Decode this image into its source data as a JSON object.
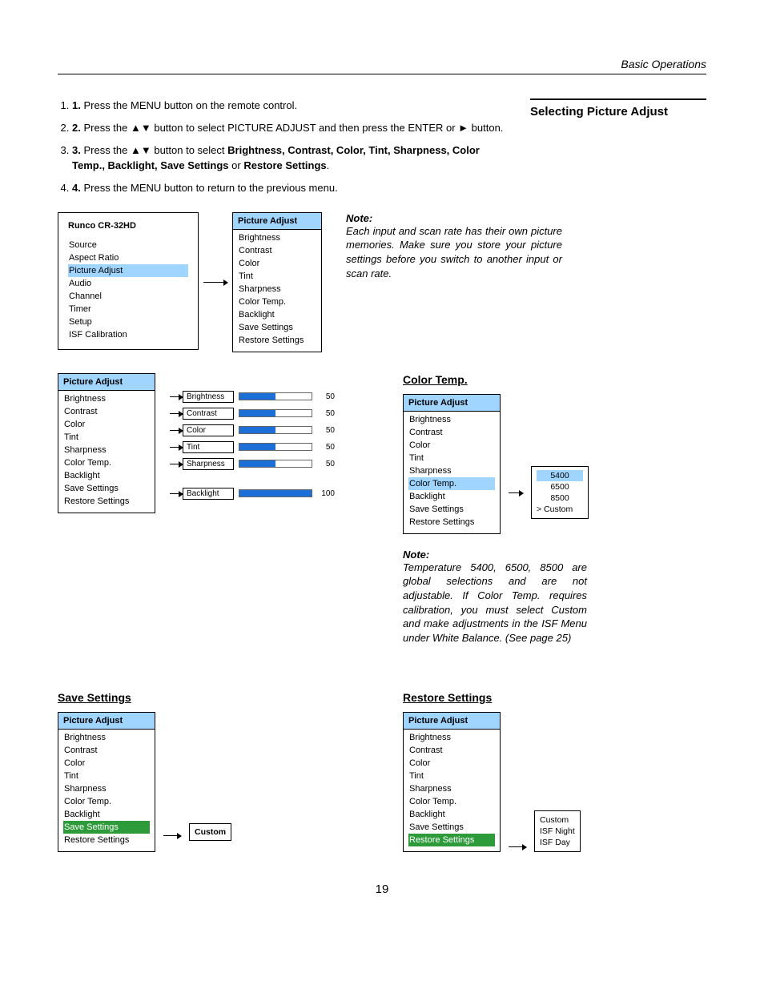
{
  "header": {
    "section": "Basic Operations"
  },
  "sideTitle": "Selecting Picture Adjust",
  "steps": {
    "s1": "Press the MENU button on the remote control.",
    "s2a": "Press the ",
    "s2b": " button to select PICTURE ADJUST and then press the ENTER or ",
    "s2c": " button.",
    "s3a": "Press the ",
    "s3b": " button to select ",
    "s3bold": "Brightness, Contrast, Color, Tint, Sharpness, Color Temp., Backlight, Save Settings",
    "s3c": " or ",
    "s3bold2": "Restore Settings",
    "s3d": ".",
    "s4": "Press the MENU button to return to the previous menu."
  },
  "mainMenu": {
    "title": "Runco CR-32HD",
    "items": [
      "Source",
      "Aspect Ratio",
      "Picture Adjust",
      "Audio",
      "Channel",
      "Timer",
      "Setup",
      "ISF Calibration"
    ],
    "highlightIndex": 2
  },
  "paMenu": {
    "title": "Picture Adjust",
    "items": [
      "Brightness",
      "Contrast",
      "Color",
      "Tint",
      "Sharpness",
      "Color Temp.",
      "Backlight",
      "Save Settings",
      "Restore Settings"
    ]
  },
  "note1": {
    "title": "Note:",
    "body": "Each input and scan rate has their own picture memories. Make sure you store your picture settings before you switch to another input or scan rate."
  },
  "sliders": [
    {
      "label": "Brightness",
      "value": 50,
      "pct": 50
    },
    {
      "label": "Contrast",
      "value": 50,
      "pct": 50
    },
    {
      "label": "Color",
      "value": 50,
      "pct": 50
    },
    {
      "label": "Tint",
      "value": 50,
      "pct": 50
    },
    {
      "label": "Sharpness",
      "value": 50,
      "pct": 50
    },
    {
      "label": "Backlight",
      "value": 100,
      "pct": 100
    }
  ],
  "leftList": [
    "Brightness",
    "Contrast",
    "Color",
    "Tint",
    "Sharpness",
    "Color Temp.",
    "Backlight",
    "Save Settings",
    "Restore Settings"
  ],
  "colorTemp": {
    "heading": "Color Temp.",
    "options": [
      "5400",
      "6500",
      "8500",
      "Custom"
    ],
    "selectedIndex": 0,
    "customMarker": ">"
  },
  "note2": {
    "title": "Note:",
    "body": "Temperature 5400, 6500, 8500 are global selections and are not adjustable. If Color Temp. requires calibration, you must select Custom and make adjustments in the ISF Menu under White Balance. (See page 25)"
  },
  "saveSettings": {
    "heading": "Save Settings",
    "highlight": "Save Settings",
    "popup": "Custom"
  },
  "restoreSettings": {
    "heading": "Restore Settings",
    "highlight": "Restore Settings",
    "popup": [
      "Custom",
      "ISF Night",
      "ISF Day"
    ]
  },
  "pageNumber": "19"
}
